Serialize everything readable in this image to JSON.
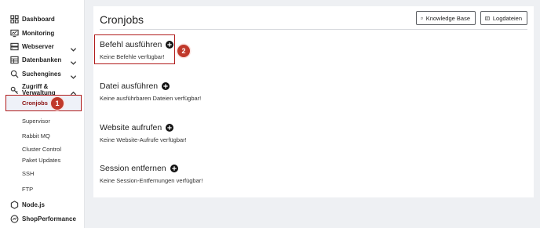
{
  "sidebar": {
    "items": [
      {
        "label": "Dashboard",
        "icon": "grid-icon"
      },
      {
        "label": "Monitoring",
        "icon": "monitor-icon"
      },
      {
        "label": "Webserver",
        "icon": "server-icon"
      },
      {
        "label": "Datenbanken",
        "icon": "database-icon"
      },
      {
        "label": "Suchengines",
        "icon": "search-icon"
      },
      {
        "label_line1": "Zugriff &",
        "label_line2": "Verwaltung",
        "icon": "key-icon"
      }
    ],
    "sub_items": {
      "active": "Cronjobs",
      "others": [
        "Supervisor",
        "Rabbit MQ",
        "Cluster Control",
        "Paket Updates",
        "SSH",
        "FTP"
      ]
    },
    "bottom_items": [
      {
        "label": "Node.js",
        "icon": "nodejs-icon"
      },
      {
        "label": "ShopPerformance",
        "icon": "performance-icon"
      }
    ]
  },
  "main": {
    "title": "Cronjobs",
    "buttons": {
      "knowledge_base": "Knowledge Base",
      "logfiles": "Logdateien"
    },
    "sections": [
      {
        "title": "Befehl ausführen",
        "empty": "Keine Befehle verfügbar!"
      },
      {
        "title": "Datei ausführen",
        "empty": "Keine ausführbaren Dateien verfügbar!"
      },
      {
        "title": "Website aufrufen",
        "empty": "Keine Website-Aufrufe verfügbar!"
      },
      {
        "title": "Session entfernen",
        "empty": "Keine Session-Entfernungen verfügbar!"
      }
    ]
  },
  "annotations": {
    "badge_1": "1",
    "badge_2": "2"
  },
  "colors": {
    "accent_red": "#b01b1b",
    "badge_red": "#c0392b",
    "background": "#eef0f3",
    "panel": "#ffffff"
  }
}
